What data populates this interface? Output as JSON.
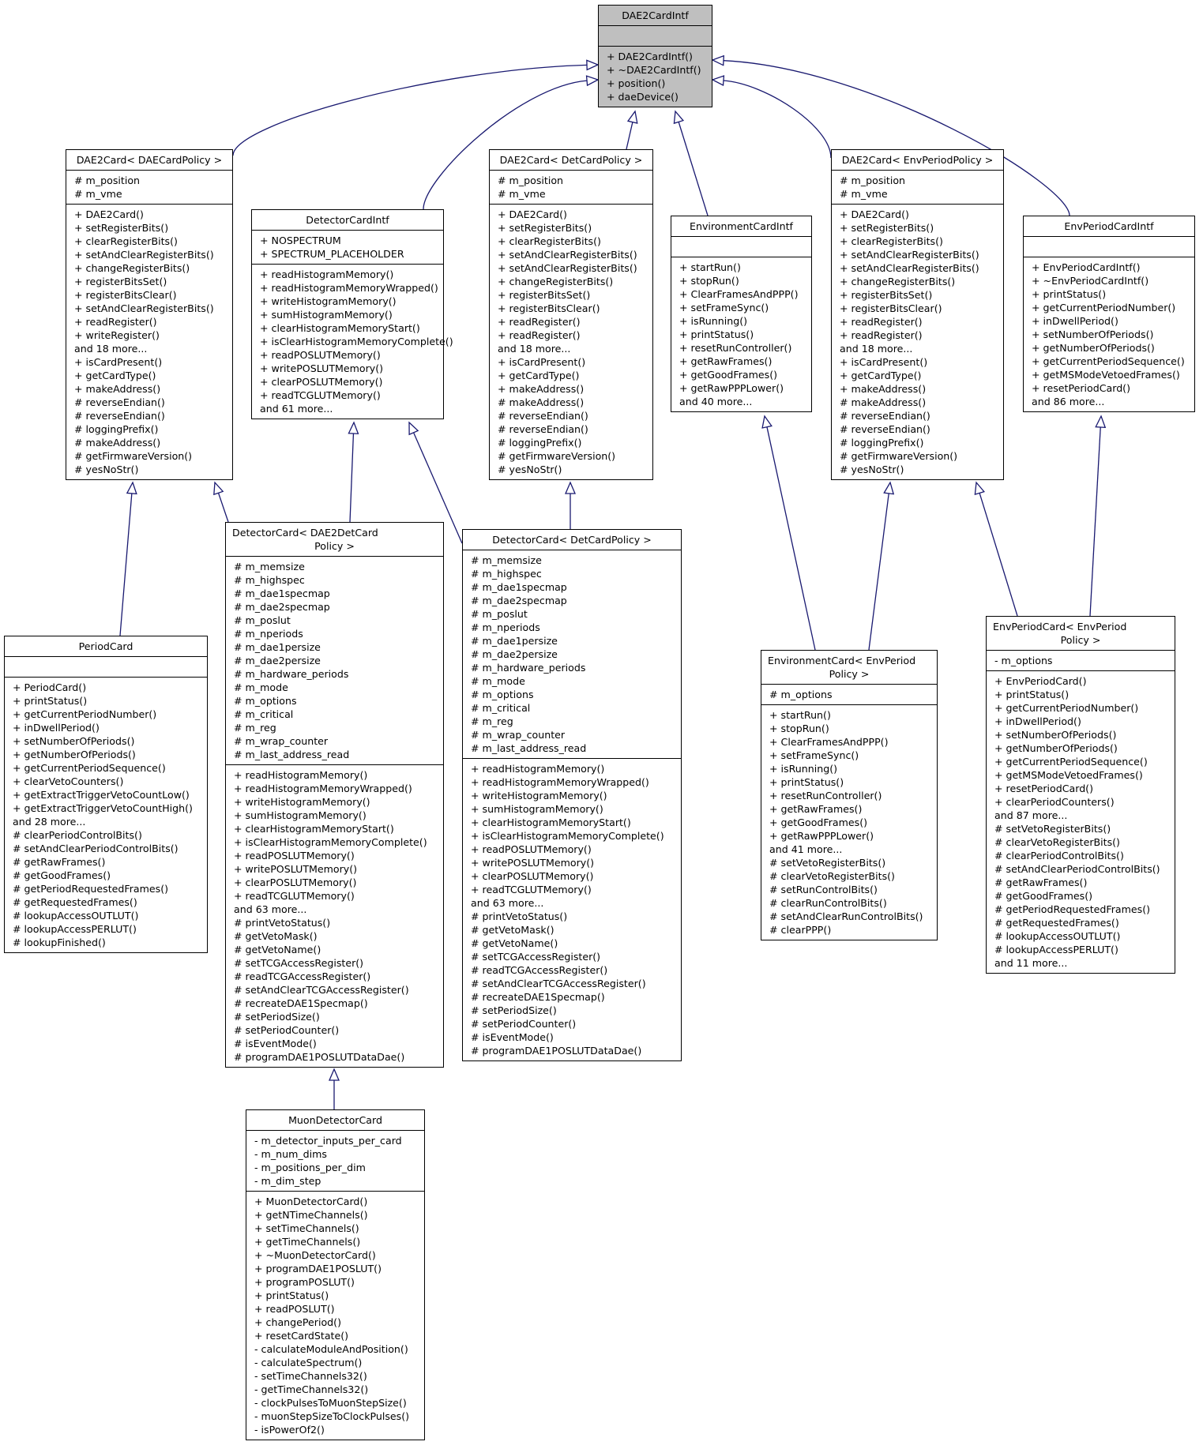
{
  "diagram": {
    "type": "uml-class-inheritance",
    "colors": {
      "edge": "#191970",
      "root_fill": "#bfbfbf",
      "box_fill": "#ffffff",
      "border": "#000000"
    },
    "classes": [
      {
        "id": "DAE2CardIntf",
        "title": [
          "DAE2CardIntf"
        ],
        "highlighted": true,
        "attributes": [],
        "operations": [
          "+ DAE2CardIntf()",
          "+ ~DAE2CardIntf()",
          "+ position()",
          "+ daeDevice()"
        ]
      },
      {
        "id": "DAE2Card_DAECardPolicy",
        "title": [
          "DAE2Card< DAECardPolicy >"
        ],
        "attributes": [
          "# m_position",
          "# m_vme"
        ],
        "operations": [
          "+ DAE2Card()",
          "+ setRegisterBits()",
          "+ clearRegisterBits()",
          "+ setAndClearRegisterBits()",
          "+ changeRegisterBits()",
          "+ registerBitsSet()",
          "+ registerBitsClear()",
          "+ setAndClearRegisterBits()",
          "+ readRegister()",
          "+ writeRegister()",
          "and 18 more...",
          "+ isCardPresent()",
          "+ getCardType()",
          "+ makeAddress()",
          "# reverseEndian()",
          "# reverseEndian()",
          "# loggingPrefix()",
          "# makeAddress()",
          "# getFirmwareVersion()",
          "# yesNoStr()"
        ]
      },
      {
        "id": "DetectorCardIntf",
        "title": [
          "DetectorCardIntf"
        ],
        "attributes": [
          "+ NOSPECTRUM",
          "+ SPECTRUM_PLACEHOLDER"
        ],
        "operations": [
          "+ readHistogramMemory()",
          "+ readHistogramMemoryWrapped()",
          "+ writeHistogramMemory()",
          "+ sumHistogramMemory()",
          "+ clearHistogramMemoryStart()",
          "+ isClearHistogramMemoryComplete()",
          "+ readPOSLUTMemory()",
          "+ writePOSLUTMemory()",
          "+ clearPOSLUTMemory()",
          "+ readTCGLUTMemory()",
          "and 61 more..."
        ]
      },
      {
        "id": "DAE2Card_DetCardPolicy",
        "title": [
          "DAE2Card< DetCardPolicy >"
        ],
        "attributes": [
          "# m_position",
          "# m_vme"
        ],
        "operations": [
          "+ DAE2Card()",
          "+ setRegisterBits()",
          "+ clearRegisterBits()",
          "+ setAndClearRegisterBits()",
          "+ setAndClearRegisterBits()",
          "+ changeRegisterBits()",
          "+ registerBitsSet()",
          "+ registerBitsClear()",
          "+ readRegister()",
          "+ readRegister()",
          "and 18 more...",
          "+ isCardPresent()",
          "+ getCardType()",
          "+ makeAddress()",
          "# makeAddress()",
          "# reverseEndian()",
          "# reverseEndian()",
          "# loggingPrefix()",
          "# getFirmwareVersion()",
          "# yesNoStr()"
        ]
      },
      {
        "id": "EnvironmentCardIntf",
        "title": [
          "EnvironmentCardIntf"
        ],
        "attributes": [],
        "operations": [
          "+ startRun()",
          "+ stopRun()",
          "+ ClearFramesAndPPP()",
          "+ setFrameSync()",
          "+ isRunning()",
          "+ printStatus()",
          "+ resetRunController()",
          "+ getRawFrames()",
          "+ getGoodFrames()",
          "+ getRawPPPLower()",
          "and 40 more..."
        ]
      },
      {
        "id": "DAE2Card_EnvPeriodPolicy",
        "title": [
          "DAE2Card< EnvPeriodPolicy >"
        ],
        "attributes": [
          "# m_position",
          "# m_vme"
        ],
        "operations": [
          "+ DAE2Card()",
          "+ setRegisterBits()",
          "+ clearRegisterBits()",
          "+ setAndClearRegisterBits()",
          "+ setAndClearRegisterBits()",
          "+ changeRegisterBits()",
          "+ registerBitsSet()",
          "+ registerBitsClear()",
          "+ readRegister()",
          "+ readRegister()",
          "and 18 more...",
          "+ isCardPresent()",
          "+ getCardType()",
          "+ makeAddress()",
          "# makeAddress()",
          "# reverseEndian()",
          "# reverseEndian()",
          "# loggingPrefix()",
          "# getFirmwareVersion()",
          "# yesNoStr()"
        ]
      },
      {
        "id": "EnvPeriodCardIntf",
        "title": [
          "EnvPeriodCardIntf"
        ],
        "attributes": [],
        "operations": [
          "+ EnvPeriodCardIntf()",
          "+ ~EnvPeriodCardIntf()",
          "+ printStatus()",
          "+ getCurrentPeriodNumber()",
          "+ inDwellPeriod()",
          "+ setNumberOfPeriods()",
          "+ getNumberOfPeriods()",
          "+ getCurrentPeriodSequence()",
          "+ getMSModeVetoedFrames()",
          "+ resetPeriodCard()",
          "and 86 more..."
        ]
      },
      {
        "id": "PeriodCard",
        "title": [
          "PeriodCard"
        ],
        "attributes": [],
        "operations": [
          "+ PeriodCard()",
          "+ printStatus()",
          "+ getCurrentPeriodNumber()",
          "+ inDwellPeriod()",
          "+ setNumberOfPeriods()",
          "+ getNumberOfPeriods()",
          "+ getCurrentPeriodSequence()",
          "+ clearVetoCounters()",
          "+ getExtractTriggerVetoCountLow()",
          "+ getExtractTriggerVetoCountHigh()",
          "and 28 more...",
          "# clearPeriodControlBits()",
          "# setAndClearPeriodControlBits()",
          "# getRawFrames()",
          "# getGoodFrames()",
          "# getPeriodRequestedFrames()",
          "# getRequestedFrames()",
          "# lookupAccessOUTLUT()",
          "# lookupAccessPERLUT()",
          "# lookupFinished()"
        ]
      },
      {
        "id": "DetectorCard_DAE2DetCardPolicy",
        "title": [
          "DetectorCard< DAE2DetCard",
          "Policy >"
        ],
        "attributes": [
          "# m_memsize",
          "# m_highspec",
          "# m_dae1specmap",
          "# m_dae2specmap",
          "# m_poslut",
          "# m_nperiods",
          "# m_dae1persize",
          "# m_dae2persize",
          "# m_hardware_periods",
          "# m_mode",
          "# m_options",
          "# m_critical",
          "# m_reg",
          "# m_wrap_counter",
          "# m_last_address_read"
        ],
        "operations": [
          "+ readHistogramMemory()",
          "+ readHistogramMemoryWrapped()",
          "+ writeHistogramMemory()",
          "+ sumHistogramMemory()",
          "+ clearHistogramMemoryStart()",
          "+ isClearHistogramMemoryComplete()",
          "+ readPOSLUTMemory()",
          "+ writePOSLUTMemory()",
          "+ clearPOSLUTMemory()",
          "+ readTCGLUTMemory()",
          "and 63 more...",
          "# printVetoStatus()",
          "# getVetoMask()",
          "# getVetoName()",
          "# setTCGAccessRegister()",
          "# readTCGAccessRegister()",
          "# setAndClearTCGAccessRegister()",
          "# recreateDAE1Specmap()",
          "# setPeriodSize()",
          "# setPeriodCounter()",
          "# isEventMode()",
          "# programDAE1POSLUTDataDae()"
        ]
      },
      {
        "id": "DetectorCard_DetCardPolicy",
        "title": [
          "DetectorCard< DetCardPolicy >"
        ],
        "attributes": [
          "# m_memsize",
          "# m_highspec",
          "# m_dae1specmap",
          "# m_dae2specmap",
          "# m_poslut",
          "# m_nperiods",
          "# m_dae1persize",
          "# m_dae2persize",
          "# m_hardware_periods",
          "# m_mode",
          "# m_options",
          "# m_critical",
          "# m_reg",
          "# m_wrap_counter",
          "# m_last_address_read"
        ],
        "operations": [
          "+ readHistogramMemory()",
          "+ readHistogramMemoryWrapped()",
          "+ writeHistogramMemory()",
          "+ sumHistogramMemory()",
          "+ clearHistogramMemoryStart()",
          "+ isClearHistogramMemoryComplete()",
          "+ readPOSLUTMemory()",
          "+ writePOSLUTMemory()",
          "+ clearPOSLUTMemory()",
          "+ readTCGLUTMemory()",
          "and 63 more...",
          "# printVetoStatus()",
          "# getVetoMask()",
          "# getVetoName()",
          "# setTCGAccessRegister()",
          "# readTCGAccessRegister()",
          "# setAndClearTCGAccessRegister()",
          "# recreateDAE1Specmap()",
          "# setPeriodSize()",
          "# setPeriodCounter()",
          "# isEventMode()",
          "# programDAE1POSLUTDataDae()"
        ]
      },
      {
        "id": "EnvironmentCard_EnvPeriodPolicy",
        "title": [
          "EnvironmentCard< EnvPeriod",
          "Policy >"
        ],
        "attributes": [
          "# m_options"
        ],
        "operations": [
          "+ startRun()",
          "+ stopRun()",
          "+ ClearFramesAndPPP()",
          "+ setFrameSync()",
          "+ isRunning()",
          "+ printStatus()",
          "+ resetRunController()",
          "+ getRawFrames()",
          "+ getGoodFrames()",
          "+ getRawPPPLower()",
          "and 41 more...",
          "# setVetoRegisterBits()",
          "# clearVetoRegisterBits()",
          "# setRunControlBits()",
          "# clearRunControlBits()",
          "# setAndClearRunControlBits()",
          "# clearPPP()"
        ]
      },
      {
        "id": "EnvPeriodCard_EnvPeriodPolicy",
        "title": [
          "EnvPeriodCard< EnvPeriod",
          "Policy >"
        ],
        "attributes": [
          "- m_options"
        ],
        "operations": [
          "+ EnvPeriodCard()",
          "+ printStatus()",
          "+ getCurrentPeriodNumber()",
          "+ inDwellPeriod()",
          "+ setNumberOfPeriods()",
          "+ getNumberOfPeriods()",
          "+ getCurrentPeriodSequence()",
          "+ getMSModeVetoedFrames()",
          "+ resetPeriodCard()",
          "+ clearPeriodCounters()",
          "and 87 more...",
          "# setVetoRegisterBits()",
          "# clearVetoRegisterBits()",
          "# clearPeriodControlBits()",
          "# setAndClearPeriodControlBits()",
          "# getRawFrames()",
          "# getGoodFrames()",
          "# getPeriodRequestedFrames()",
          "# getRequestedFrames()",
          "# lookupAccessOUTLUT()",
          "# lookupAccessPERLUT()",
          "and 11 more..."
        ]
      },
      {
        "id": "MuonDetectorCard",
        "title": [
          "MuonDetectorCard"
        ],
        "attributes": [
          "- m_detector_inputs_per_card",
          "- m_num_dims",
          "- m_positions_per_dim",
          "- m_dim_step"
        ],
        "operations": [
          "+ MuonDetectorCard()",
          "+ getNTimeChannels()",
          "+ setTimeChannels()",
          "+ getTimeChannels()",
          "+ ~MuonDetectorCard()",
          "+ programDAE1POSLUT()",
          "+ programPOSLUT()",
          "+ printStatus()",
          "+ readPOSLUT()",
          "+ changePeriod()",
          "+ resetCardState()",
          "- calculateModuleAndPosition()",
          "- calculateSpectrum()",
          "- setTimeChannels32()",
          "- getTimeChannels32()",
          "- clockPulsesToMuonStepSize()",
          "- muonStepSizeToClockPulses()",
          "- isPowerOf2()"
        ]
      }
    ],
    "inheritance": [
      {
        "child": "DAE2Card_DAECardPolicy",
        "parent": "DAE2CardIntf"
      },
      {
        "child": "DetectorCardIntf",
        "parent": "DAE2CardIntf"
      },
      {
        "child": "DAE2Card_DetCardPolicy",
        "parent": "DAE2CardIntf"
      },
      {
        "child": "EnvironmentCardIntf",
        "parent": "DAE2CardIntf"
      },
      {
        "child": "DAE2Card_EnvPeriodPolicy",
        "parent": "DAE2CardIntf"
      },
      {
        "child": "EnvPeriodCardIntf",
        "parent": "DAE2CardIntf"
      },
      {
        "child": "PeriodCard",
        "parent": "DAE2Card_DAECardPolicy"
      },
      {
        "child": "DetectorCard_DAE2DetCardPolicy",
        "parent": "DAE2Card_DAECardPolicy"
      },
      {
        "child": "DetectorCard_DAE2DetCardPolicy",
        "parent": "DetectorCardIntf"
      },
      {
        "child": "DetectorCard_DetCardPolicy",
        "parent": "DetectorCardIntf"
      },
      {
        "child": "DetectorCard_DetCardPolicy",
        "parent": "DAE2Card_DetCardPolicy"
      },
      {
        "child": "EnvironmentCard_EnvPeriodPolicy",
        "parent": "EnvironmentCardIntf"
      },
      {
        "child": "EnvironmentCard_EnvPeriodPolicy",
        "parent": "DAE2Card_EnvPeriodPolicy"
      },
      {
        "child": "EnvPeriodCard_EnvPeriodPolicy",
        "parent": "DAE2Card_EnvPeriodPolicy"
      },
      {
        "child": "EnvPeriodCard_EnvPeriodPolicy",
        "parent": "EnvPeriodCardIntf"
      },
      {
        "child": "MuonDetectorCard",
        "parent": "DetectorCard_DAE2DetCardPolicy"
      }
    ]
  }
}
